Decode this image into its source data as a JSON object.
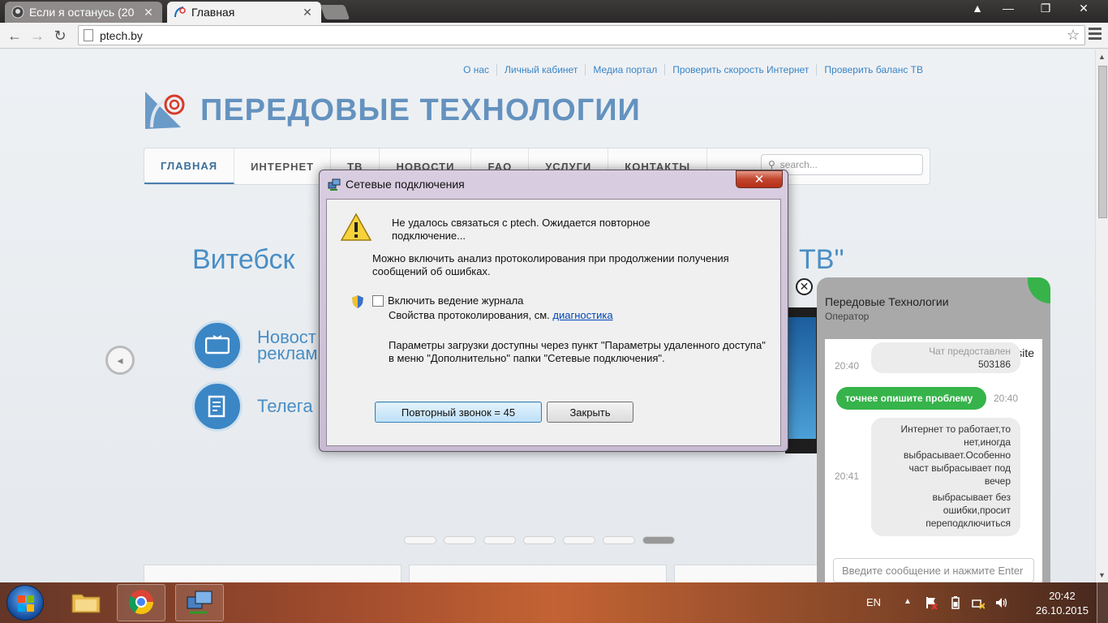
{
  "browser": {
    "tabs": [
      {
        "title": "Если я останусь (20",
        "active": false
      },
      {
        "title": "Главная",
        "active": true
      }
    ],
    "url": "ptech.by"
  },
  "site": {
    "toplinks": [
      "О нас",
      "Личный кабинет",
      "Медиа портал",
      "Проверить скорость Интернет",
      "Проверить баланс ТВ"
    ],
    "logo_text": "ПЕРЕДОВЫЕ ТЕХНОЛОГИИ",
    "menu": [
      "ГЛАВНАЯ",
      "ИНТЕРНЕТ",
      "ТВ",
      "НОВОСТИ",
      "FAQ",
      "УСЛУГИ",
      "КОНТАКТЫ"
    ],
    "search_placeholder": "search...",
    "headline_left": "Витебск",
    "headline_right": "ТВ\"",
    "features": [
      {
        "line1": "Новост",
        "line2": "реклам"
      },
      {
        "line1": "Телега",
        "line2": ""
      }
    ]
  },
  "dialog": {
    "title": "Сетевые подключения",
    "message1": "Не удалось связаться с ptech. Ожидается повторное подключение...",
    "message2": "Можно включить анализ протоколирования при продолжении получения сообщений об ошибках.",
    "checkbox_label": "Включить ведение журнала",
    "props_text": "Свойства протоколирования, см.",
    "props_link": "диагностика",
    "message3": "Параметры загрузки доступны через пункт \"Параметры удаленного доступа\" в меню \"Дополнительно\" папки \"Сетевые подключения\".",
    "redial_button": "Повторный звонок = 45",
    "close_button": "Закрыть",
    "close_x": "✕"
  },
  "chat": {
    "header_name": "Передовые Технологии",
    "header_role": "Оператор",
    "brand": "jivosite",
    "messages": [
      {
        "dir": "in",
        "text": "Чат предоставлен",
        "text2": "503186",
        "time": "20:40"
      },
      {
        "dir": "out",
        "text": "точнее опишите проблему",
        "time": "20:40"
      },
      {
        "dir": "in",
        "lines": [
          "Интернет то работает,то",
          "нет,иногда",
          "выбрасывает.Особенно",
          "част выбрасывает под",
          "вечер",
          "выбрасывает без",
          "ошибки,просит",
          "переподключиться"
        ],
        "time": "20:41"
      }
    ],
    "input_placeholder": "Введите сообщение и нажмите Enter",
    "close_label": "✕"
  },
  "taskbar": {
    "lang": "EN",
    "time": "20:42",
    "date": "26.10.2015"
  },
  "colors": {
    "accent": "#4a8ec5",
    "chat_green": "#36b34a",
    "dialog_close": "#c2442c"
  }
}
